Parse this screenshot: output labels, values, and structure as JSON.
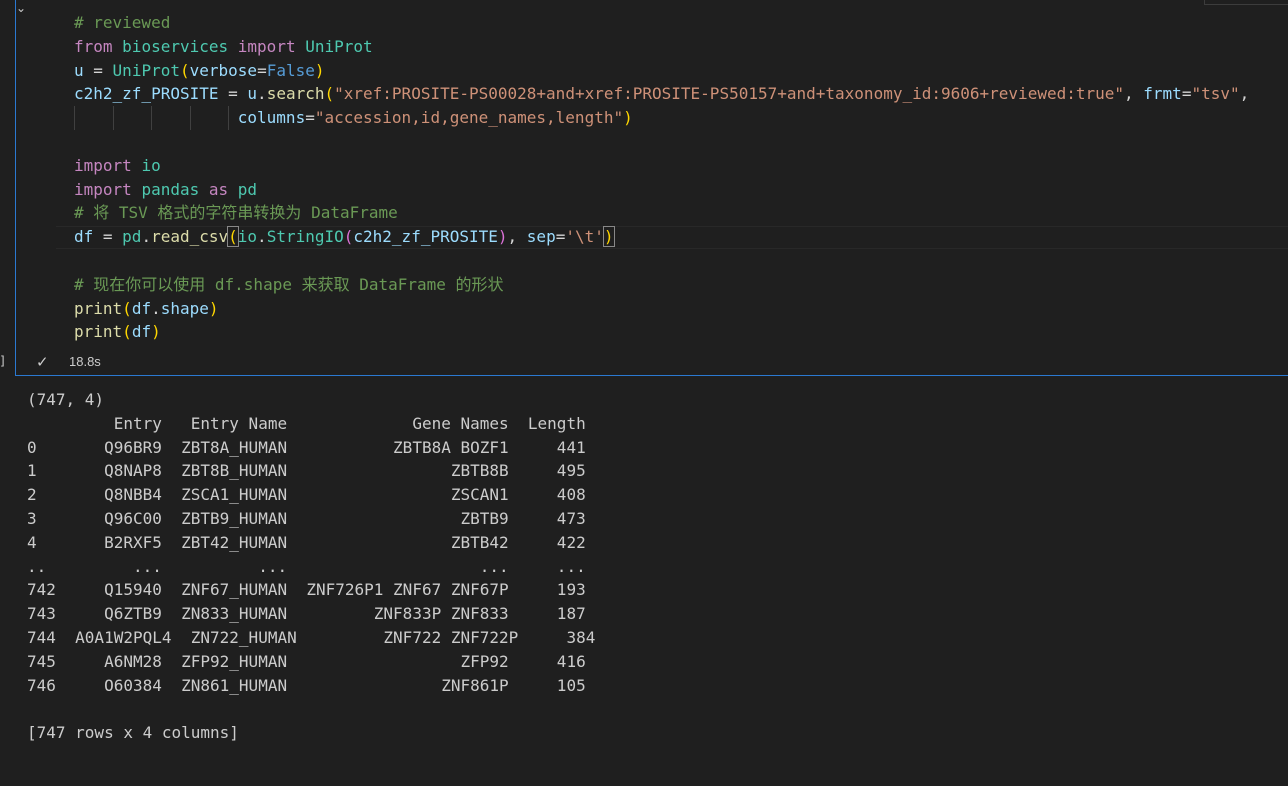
{
  "status": {
    "check_icon": "check-icon",
    "time": "18.8s"
  },
  "code": {
    "line1": "# reviewed",
    "line2_kw1": "from",
    "line2_mod": "bioservices",
    "line2_kw2": "import",
    "line2_cls": "UniProt",
    "line3_var": "u",
    "line3_eq": " = ",
    "line3_cls": "UniProt",
    "line3_p1": "(",
    "line3_param": "verbose",
    "line3_eq2": "=",
    "line3_const": "False",
    "line3_p2": ")",
    "line4_var": "c2h2_zf_PROSITE",
    "line4_eq": " = ",
    "line4_obj": "u",
    "line4_dot": ".",
    "line4_fn": "search",
    "line4_p1": "(",
    "line4_str": "\"xref:PROSITE-PS00028+and+xref:PROSITE-PS50157+and+taxonomy_id:9606+reviewed:true\"",
    "line4_comma": ", ",
    "line4_param": "frmt",
    "line4_eq2": "=",
    "line4_str2": "\"tsv\"",
    "line4_comma2": ",",
    "line5_param": "columns",
    "line5_eq": "=",
    "line5_str": "\"accession,id,gene_names,length\"",
    "line5_p": ")",
    "line7_kw": "import",
    "line7_mod": "io",
    "line8_kw1": "import",
    "line8_mod": "pandas",
    "line8_kw2": "as",
    "line8_alias": "pd",
    "line9": "# 将 TSV 格式的字符串转换为 DataFrame",
    "line10_var": "df",
    "line10_eq": " = ",
    "line10_mod": "pd",
    "line10_dot": ".",
    "line10_fn": "read_csv",
    "line10_p1": "(",
    "line10_mod2": "io",
    "line10_dot2": ".",
    "line10_fn2": "StringIO",
    "line10_p2": "(",
    "line10_arg": "c2h2_zf_PROSITE",
    "line10_p2c": ")",
    "line10_comma": ", ",
    "line10_param": "sep",
    "line10_eq2": "=",
    "line10_str": "'\\t'",
    "line10_p1c": ")",
    "line12": "# 现在你可以使用 df.shape 来获取 DataFrame 的形状",
    "line13_fn": "print",
    "line13_p1": "(",
    "line13_var": "df",
    "line13_dot": ".",
    "line13_attr": "shape",
    "line13_p1c": ")",
    "line14_fn": "print",
    "line14_p1": "(",
    "line14_var": "df",
    "line14_p1c": ")"
  },
  "output": {
    "shape": "(747, 4)",
    "header": "         Entry   Entry Name             Gene Names  Length",
    "rows": [
      "0       Q96BR9  ZBT8A_HUMAN           ZBTB8A BOZF1     441",
      "1       Q8NAP8  ZBT8B_HUMAN                 ZBTB8B     495",
      "2       Q8NBB4  ZSCA1_HUMAN                 ZSCAN1     408",
      "3       Q96C00  ZBTB9_HUMAN                  ZBTB9     473",
      "4       B2RXF5  ZBT42_HUMAN                 ZBTB42     422",
      "..         ...          ...                    ...     ...",
      "742     Q15940  ZNF67_HUMAN  ZNF726P1 ZNF67 ZNF67P     193",
      "743     Q6ZTB9  ZN833_HUMAN         ZNF833P ZNF833     187",
      "744  A0A1W2PQL4  ZN722_HUMAN         ZNF722 ZNF722P     384",
      "745     A6NM28  ZFP92_HUMAN                  ZFP92     416",
      "746     O60384  ZN861_HUMAN                ZNF861P     105"
    ],
    "footer": "[747 rows x 4 columns]"
  }
}
